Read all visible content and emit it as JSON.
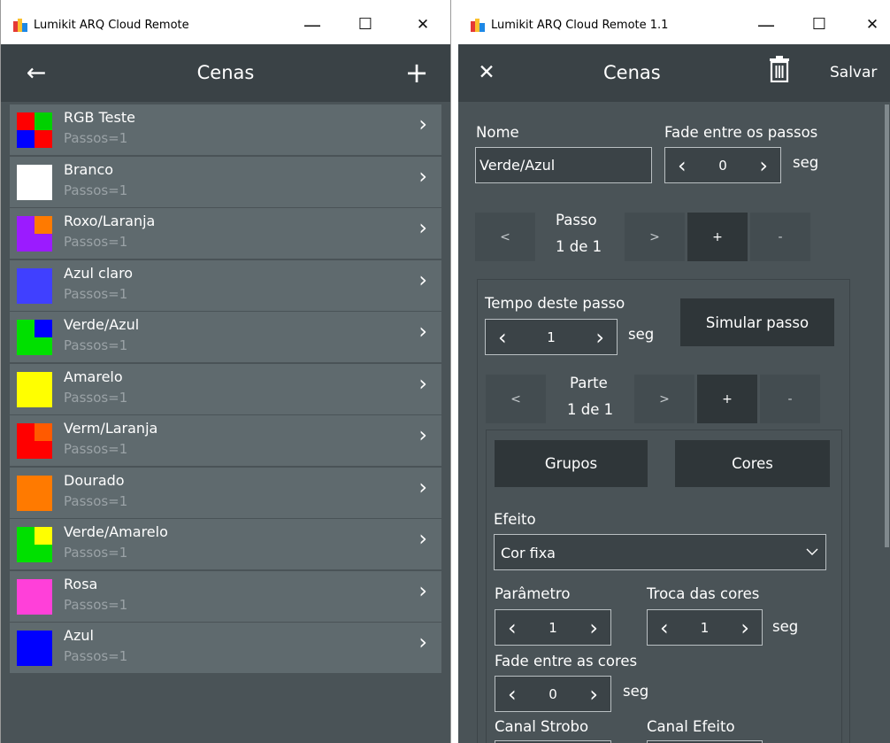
{
  "left_window": {
    "title": "Lumikit ARQ Cloud Remote",
    "header_title": "Cenas",
    "back_icon": "←",
    "add_icon": "+",
    "chevron": "›",
    "scenes": [
      {
        "name": "RGB Teste",
        "steps": "Passos=1",
        "swatch": [
          "#ff0000",
          "#00d100",
          "#0000ff",
          "#ff0000"
        ]
      },
      {
        "name": "Branco",
        "steps": "Passos=1",
        "swatch": [
          "#ffffff"
        ]
      },
      {
        "name": "Roxo/Laranja",
        "steps": "Passos=1",
        "swatch": [
          "#9b1bff",
          "#ff7a00",
          "#9b1bff",
          "#9b1bff"
        ]
      },
      {
        "name": "Azul claro",
        "steps": "Passos=1",
        "swatch": [
          "#4040ff"
        ]
      },
      {
        "name": "Verde/Azul",
        "steps": "Passos=1",
        "swatch": [
          "#00e000",
          "#0000ff",
          "#00e000",
          "#00e000"
        ]
      },
      {
        "name": "Amarelo",
        "steps": "Passos=1",
        "swatch": [
          "#ffff00"
        ]
      },
      {
        "name": "Verm/Laranja",
        "steps": "Passos=1",
        "swatch": [
          "#ff0000",
          "#ff5a00",
          "#ff0000",
          "#ff0000"
        ]
      },
      {
        "name": "Dourado",
        "steps": "Passos=1",
        "swatch": [
          "#ff7a00"
        ]
      },
      {
        "name": "Verde/Amarelo",
        "steps": "Passos=1",
        "swatch": [
          "#00e000",
          "#ffff00",
          "#00e000",
          "#00e000"
        ]
      },
      {
        "name": "Rosa",
        "steps": "Passos=1",
        "swatch": [
          "#ff40d9"
        ]
      },
      {
        "name": "Azul",
        "steps": "Passos=1",
        "swatch": [
          "#0000ff"
        ]
      }
    ]
  },
  "right_window": {
    "title": "Lumikit ARQ Cloud Remote 1.1",
    "header_title": "Cenas",
    "close_icon": "✕",
    "save_label": "Salvar",
    "name_label": "Nome",
    "name_value": "Verde/Azul",
    "fade_steps_label": "Fade entre os passos",
    "fade_steps_value": "0",
    "sec": "seg",
    "step_label": "Passo",
    "step_value": "1 de 1",
    "step_time_label": "Tempo deste passo",
    "step_time_value": "1",
    "simulate_label": "Simular passo",
    "part_label": "Parte",
    "part_value": "1 de 1",
    "groups_label": "Grupos",
    "colors_label": "Cores",
    "effect_label": "Efeito",
    "effect_value": "Cor fixa",
    "param_label": "Parâmetro",
    "param_value": "1",
    "color_swap_label": "Troca das cores",
    "color_swap_value": "1",
    "fade_colors_label": "Fade entre as cores",
    "fade_colors_value": "0",
    "strobe_label": "Canal Strobo",
    "effect_channel_label": "Canal Efeito",
    "prev": "<",
    "next": ">",
    "plus": "+",
    "minus": "-",
    "arrow_left": "‹",
    "arrow_right": "›"
  },
  "window_controls": {
    "minimize": "—",
    "maximize": "☐",
    "close": "✕"
  }
}
